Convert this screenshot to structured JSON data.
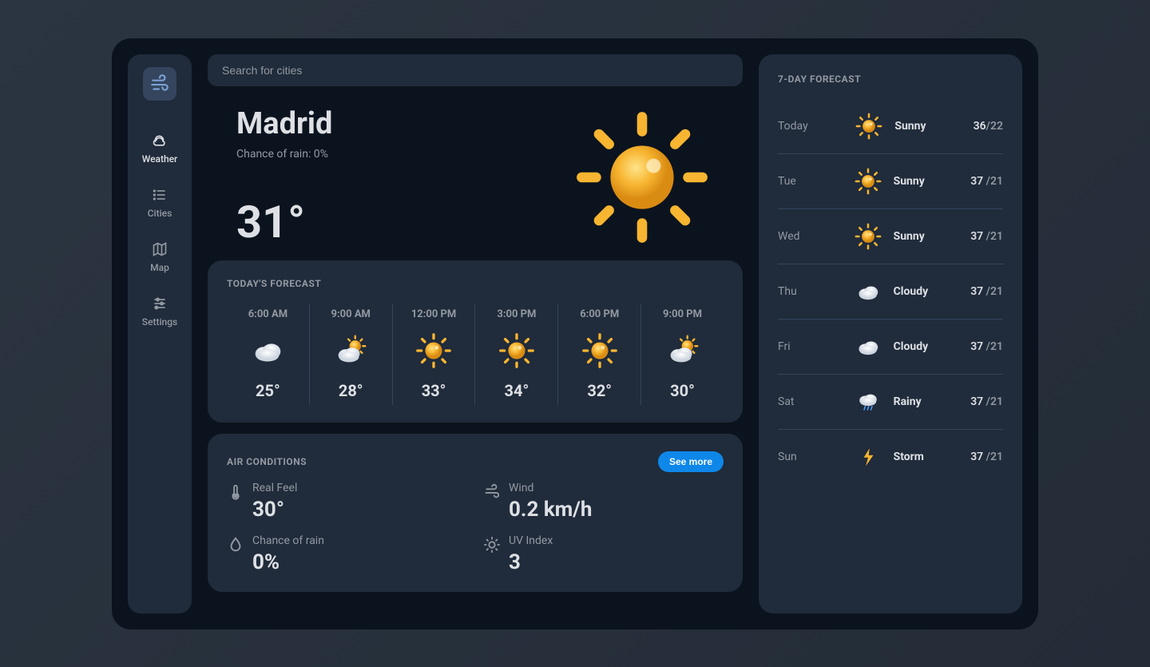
{
  "search": {
    "placeholder": "Search for cities"
  },
  "nav": [
    {
      "label": "Weather",
      "icon": "weather",
      "active": true
    },
    {
      "label": "Cities",
      "icon": "list",
      "active": false
    },
    {
      "label": "Map",
      "icon": "map",
      "active": false
    },
    {
      "label": "Settings",
      "icon": "sliders",
      "active": false
    }
  ],
  "current": {
    "city": "Madrid",
    "rain_label": "Chance of rain: 0%",
    "temp": "31°",
    "icon": "sunny"
  },
  "today": {
    "title": "TODAY'S FORECAST",
    "hours": [
      {
        "time": "6:00 AM",
        "temp": "25°",
        "icon": "cloudy"
      },
      {
        "time": "9:00 AM",
        "temp": "28°",
        "icon": "partly"
      },
      {
        "time": "12:00 PM",
        "temp": "33°",
        "icon": "sunny"
      },
      {
        "time": "3:00 PM",
        "temp": "34°",
        "icon": "sunny"
      },
      {
        "time": "6:00 PM",
        "temp": "32°",
        "icon": "sunny"
      },
      {
        "time": "9:00 PM",
        "temp": "30°",
        "icon": "partly"
      }
    ]
  },
  "air": {
    "title": "AIR CONDITIONS",
    "see_more": "See more",
    "items": [
      {
        "label": "Real Feel",
        "value": "30°",
        "icon": "thermometer"
      },
      {
        "label": "Wind",
        "value": "0.2 km/h",
        "icon": "wind"
      },
      {
        "label": "Chance of rain",
        "value": "0%",
        "icon": "drop"
      },
      {
        "label": "UV Index",
        "value": "3",
        "icon": "sun"
      }
    ]
  },
  "week": {
    "title": "7-DAY FORECAST",
    "days": [
      {
        "day": "Today",
        "cond": "Sunny",
        "icon": "sunny",
        "hi": "36",
        "lo": "/22"
      },
      {
        "day": "Tue",
        "cond": "Sunny",
        "icon": "sunny",
        "hi": "37",
        "lo": " /21"
      },
      {
        "day": "Wed",
        "cond": "Sunny",
        "icon": "sunny",
        "hi": "37",
        "lo": " /21"
      },
      {
        "day": "Thu",
        "cond": "Cloudy",
        "icon": "cloudy",
        "hi": "37",
        "lo": " /21"
      },
      {
        "day": "Fri",
        "cond": "Cloudy",
        "icon": "cloudy",
        "hi": "37",
        "lo": " /21"
      },
      {
        "day": "Sat",
        "cond": "Rainy",
        "icon": "rainy",
        "hi": "37",
        "lo": " /21"
      },
      {
        "day": "Sun",
        "cond": "Storm",
        "icon": "storm",
        "hi": "37",
        "lo": " /21"
      }
    ]
  }
}
